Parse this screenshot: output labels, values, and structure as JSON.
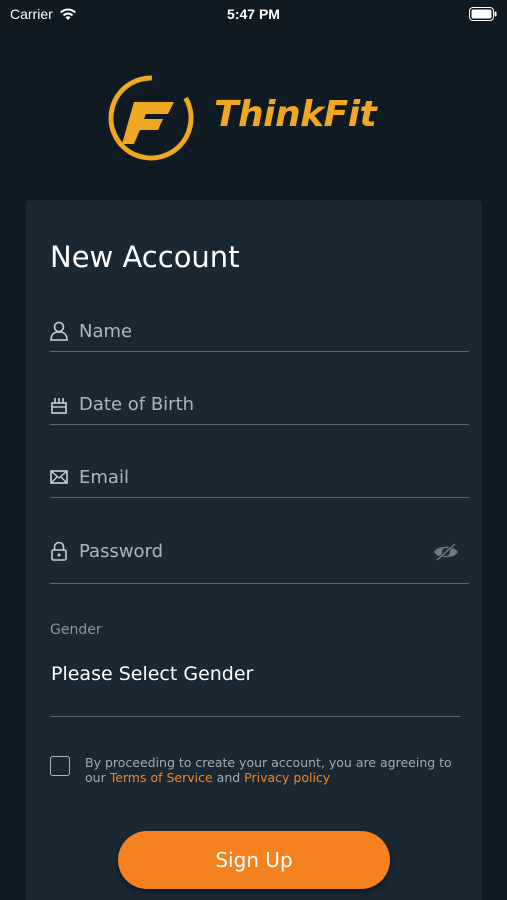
{
  "status_bar": {
    "carrier": "Carrier",
    "time": "5:47 PM"
  },
  "brand": {
    "name": "ThinkFit",
    "logo_letter": "F",
    "color": "#f0a823"
  },
  "form": {
    "title": "New Account",
    "fields": {
      "name": {
        "placeholder": "Name",
        "icon": "user-icon"
      },
      "dob": {
        "placeholder": "Date of Birth",
        "icon": "cake-icon"
      },
      "email": {
        "placeholder": "Email",
        "icon": "envelope-icon"
      },
      "password": {
        "placeholder": "Password",
        "icon": "lock-icon",
        "toggle_icon": "eye-slash-icon"
      }
    },
    "gender": {
      "label": "Gender",
      "value": "Please Select Gender"
    },
    "consent": {
      "prefix": "By proceeding  to create your account, you are agreeing to our ",
      "terms_link": "Terms of Service",
      "conjunction": " and ",
      "privacy_link": "Privacy policy",
      "checked": false
    },
    "submit_label": "Sign Up"
  },
  "colors": {
    "background": "#0f1a22",
    "card": "#1a2833",
    "accent": "#f5821f"
  }
}
